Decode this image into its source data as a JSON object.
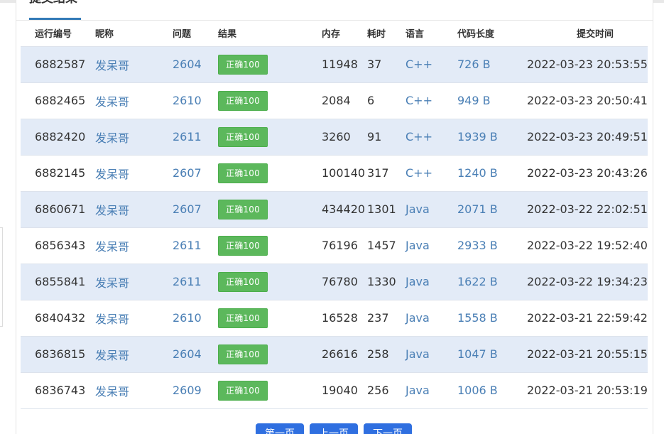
{
  "card": {
    "title": "提交结果"
  },
  "table": {
    "headers": {
      "id": "运行编号",
      "nick": "昵称",
      "problem": "问题",
      "result": "结果",
      "memory": "内存",
      "time": "耗时",
      "lang": "语言",
      "code_len": "代码长度",
      "submit_time": "提交时间"
    },
    "rows": [
      {
        "id": "6882587",
        "nick": "发呆哥",
        "problem": "2604",
        "result": "正确100",
        "memory": "11948",
        "time": "37",
        "lang": "C++",
        "code_len": "726 B",
        "submit_time": "2022-03-23 20:53:55"
      },
      {
        "id": "6882465",
        "nick": "发呆哥",
        "problem": "2610",
        "result": "正确100",
        "memory": "2084",
        "time": "6",
        "lang": "C++",
        "code_len": "949 B",
        "submit_time": "2022-03-23 20:50:41"
      },
      {
        "id": "6882420",
        "nick": "发呆哥",
        "problem": "2611",
        "result": "正确100",
        "memory": "3260",
        "time": "91",
        "lang": "C++",
        "code_len": "1939 B",
        "submit_time": "2022-03-23 20:49:51"
      },
      {
        "id": "6882145",
        "nick": "发呆哥",
        "problem": "2607",
        "result": "正确100",
        "memory": "100140",
        "time": "317",
        "lang": "C++",
        "code_len": "1240 B",
        "submit_time": "2022-03-23 20:43:26"
      },
      {
        "id": "6860671",
        "nick": "发呆哥",
        "problem": "2607",
        "result": "正确100",
        "memory": "434420",
        "time": "1301",
        "lang": "Java",
        "code_len": "2071 B",
        "submit_time": "2022-03-22 22:02:51"
      },
      {
        "id": "6856343",
        "nick": "发呆哥",
        "problem": "2611",
        "result": "正确100",
        "memory": "76196",
        "time": "1457",
        "lang": "Java",
        "code_len": "2933 B",
        "submit_time": "2022-03-22 19:52:40"
      },
      {
        "id": "6855841",
        "nick": "发呆哥",
        "problem": "2611",
        "result": "正确100",
        "memory": "76780",
        "time": "1330",
        "lang": "Java",
        "code_len": "1622 B",
        "submit_time": "2022-03-22 19:34:23"
      },
      {
        "id": "6840432",
        "nick": "发呆哥",
        "problem": "2610",
        "result": "正确100",
        "memory": "16528",
        "time": "237",
        "lang": "Java",
        "code_len": "1558 B",
        "submit_time": "2022-03-21 22:59:42"
      },
      {
        "id": "6836815",
        "nick": "发呆哥",
        "problem": "2604",
        "result": "正确100",
        "memory": "26616",
        "time": "258",
        "lang": "Java",
        "code_len": "1047 B",
        "submit_time": "2022-03-21 20:55:15"
      },
      {
        "id": "6836743",
        "nick": "发呆哥",
        "problem": "2609",
        "result": "正确100",
        "memory": "19040",
        "time": "256",
        "lang": "Java",
        "code_len": "1006 B",
        "submit_time": "2022-03-21 20:53:19"
      }
    ]
  },
  "pager": {
    "first": "第一页",
    "prev": "上一页",
    "next": "下一页"
  },
  "colors": {
    "link": "#4a7fb5",
    "badge": "#5cb85c",
    "stripe": "#e3ebf7",
    "pager": "#2f6fe0"
  }
}
